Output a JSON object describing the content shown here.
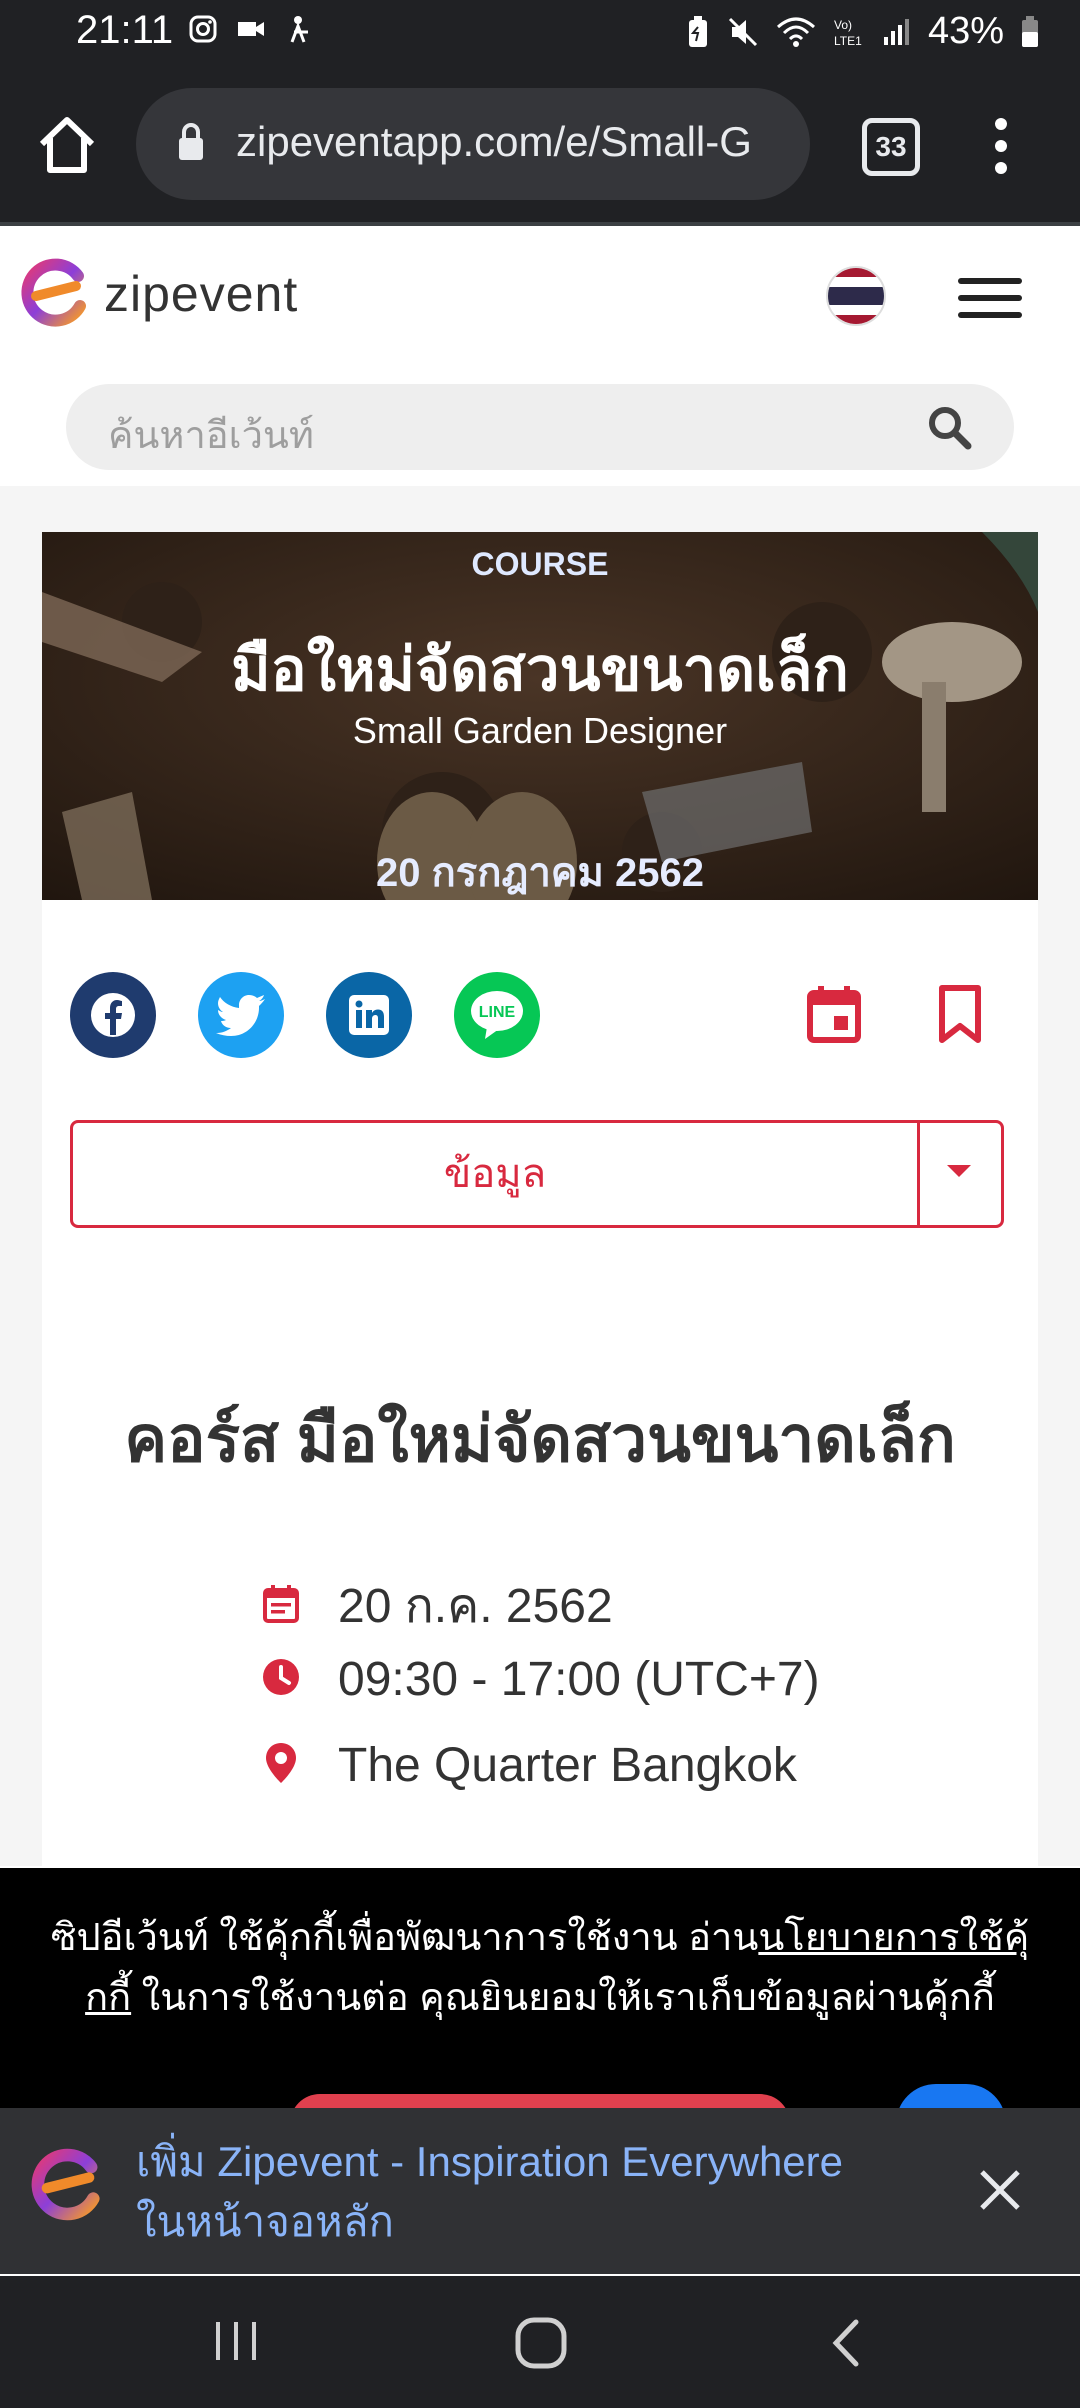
{
  "status_bar": {
    "time": "21:11",
    "battery": "43%",
    "left_icons": [
      "instagram-icon",
      "video-icon",
      "accessibility-icon"
    ],
    "right_icons": [
      "battery-saver-icon",
      "mute-icon",
      "wifi-icon",
      "volte-icon",
      "signal-icon",
      "battery-icon"
    ]
  },
  "browser": {
    "url": "zipeventapp.com/e/Small-G",
    "tab_count": "33"
  },
  "site": {
    "brand": "zipevent",
    "search_placeholder": "ค้นหาอีเว้นท์"
  },
  "banner": {
    "tag": "COURSE",
    "title_th": "มือใหม่จัดสวนขนาดเล็ก",
    "title_en": "Small Garden Designer",
    "date": "20 กรกฎาคม 2562"
  },
  "share": {
    "buttons": [
      "facebook",
      "twitter",
      "linkedin",
      "line"
    ],
    "line_label": "LINE"
  },
  "dropdown": {
    "selected": "ข้อมูล"
  },
  "event": {
    "title": "คอร์ส มือใหม่จัดสวนขนาดเล็ก",
    "date": "20 ก.ค. 2562",
    "time": "09:30 - 17:00 (UTC+7)",
    "venue": "The Quarter Bangkok"
  },
  "cookie": {
    "text_before": "ซิปอีเว้นท์ ใช้คุ้กกี้เพื่อพัฒนาการใช้งาน อ่าน",
    "link": "นโยบายการใช้คุ้กกี้",
    "text_after": " ในการใช้งานต่อ คุณยินยอมให้เราเก็บข้อมูลผ่านคุ้กกี้"
  },
  "install_banner": {
    "line1": "เพิ่ม Zipevent - Inspiration Everywhere",
    "line2": "ในหน้าจอหลัก"
  },
  "colors": {
    "accent": "#d8293f",
    "facebook": "#1f3b6e",
    "twitter": "#1da1f2",
    "linkedin": "#0a66a6",
    "line": "#06c755"
  }
}
